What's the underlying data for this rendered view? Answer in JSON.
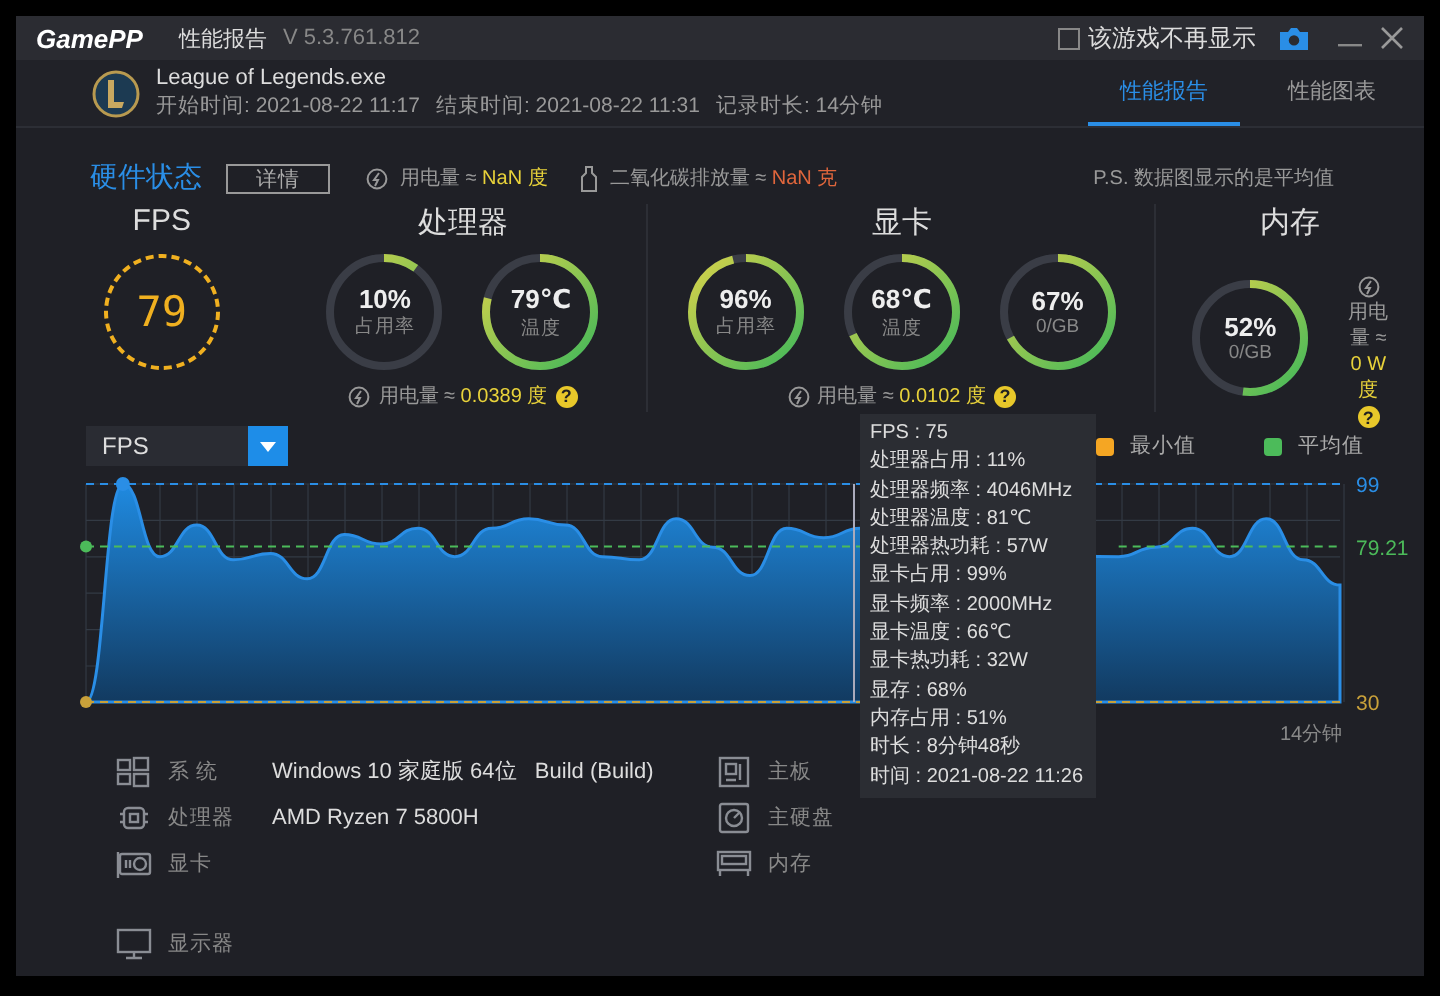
{
  "window": {
    "logo": "GamePP",
    "title": "性能报告",
    "version": "V 5.3.761.812",
    "hide_checkbox": {
      "label": "该游戏不再显示",
      "checked": false
    }
  },
  "game": {
    "name": "League of Legends.exe",
    "start": "开始时间: 2021-08-22 11:17",
    "end": "结束时间: 2021-08-22 11:31",
    "duration": "记录时长: 14分钟"
  },
  "tabs": [
    {
      "label": "性能报告",
      "selected": true
    },
    {
      "label": "性能图表",
      "selected": false
    }
  ],
  "status": {
    "title": "硬件状态",
    "details_button": "详情",
    "power_label": "用电量 ≈",
    "power_value": "NaN 度",
    "co2_label": "二氧化碳排放量 ≈",
    "co2_value": "NaN 克",
    "note": "P.S. 数据图显示的是平均值"
  },
  "fps": {
    "title": "FPS",
    "value": "79"
  },
  "groups": [
    {
      "title": "处理器",
      "kind": "below",
      "gauges": [
        {
          "value": "10%",
          "label": "占用率",
          "level": 0.1
        },
        {
          "value": "79℃",
          "label": "温度",
          "level": 0.79
        }
      ],
      "power_label": "用电量 ≈",
      "power_value": "0.0389 度",
      "help": "?"
    },
    {
      "title": "显卡",
      "kind": "below",
      "gauges": [
        {
          "value": "96%",
          "label": "占用率",
          "level": 0.96
        },
        {
          "value": "68℃",
          "label": "温度",
          "level": 0.68
        },
        {
          "value": "67%",
          "label": "0/GB",
          "level": 0.67
        }
      ],
      "power_label": "用电量 ≈",
      "power_value": "0.0102 度",
      "help": "?"
    },
    {
      "title": "内存",
      "kind": "side",
      "gauges": [
        {
          "value": "52%",
          "label": "0/GB",
          "level": 0.52
        }
      ],
      "power_label": "用电量 ≈",
      "power_value": "0 W度",
      "help": "?"
    }
  ],
  "chart": {
    "legend": [
      {
        "label": "最小值",
        "color": "#f5a623"
      }
    ],
    "end_label": "14分钟",
    "chart_data": {
      "type": "area",
      "ylim": [
        30,
        99
      ],
      "yticks": [
        30,
        79.21,
        99
      ],
      "grid": true,
      "series": [
        {
          "name": "FPS",
          "color": "#2a8ee6",
          "values": [
            30,
            99,
            76,
            86,
            75,
            77,
            69,
            83,
            80,
            85,
            76,
            85,
            88,
            86,
            76,
            75,
            88,
            79,
            70,
            85,
            82,
            85,
            null,
            null,
            null,
            null,
            null,
            null,
            76,
            79,
            85,
            76,
            88,
            75,
            67
          ]
        },
        {
          "name": "平均值",
          "type": "line",
          "line_style": "dashed",
          "color": "#4cbb5a",
          "values": [
            79.21,
            79.21,
            79.21,
            79.21,
            79.21,
            79.21,
            79.21,
            79.21,
            79.21,
            79.21,
            79.21,
            79.21,
            79.21,
            79.21,
            79.21,
            79.21,
            79.21,
            79.21,
            79.21,
            79.21,
            79.21,
            79.21,
            null,
            null,
            null,
            null,
            null,
            null,
            79.21,
            79.21,
            79.21,
            79.21,
            79.21,
            79.21,
            79.21
          ]
        }
      ]
    }
  },
  "tooltip": {
    "lines": [
      "FPS : 75",
      "处理器占用 : 11%",
      "处理器频率 : 4046MHz",
      "处理器温度 : 81℃",
      "处理器热功耗 : 57W",
      "显卡占用 : 99%",
      "显卡频率 : 2000MHz",
      "显卡温度 : 66℃",
      "显卡热功耗 : 32W",
      "显存 : 68%",
      "内存占用 : 51%",
      "时长 : 8分钟48秒",
      "时间 : 2021-08-22 11:26"
    ]
  },
  "system_info": {
    "left": [
      {
        "label": "系 统",
        "value": "Windows 10 家庭版 64位   Build (Build)"
      },
      {
        "label": "处理器",
        "value": "AMD Ryzen 7 5800H"
      },
      {
        "label": "显卡"
      }
    ],
    "right": [
      {
        "label": "主板"
      },
      {
        "label": "主硬盘"
      },
      {
        "label": "内存"
      }
    ],
    "monitor": {
      "label": "显示器"
    }
  }
}
